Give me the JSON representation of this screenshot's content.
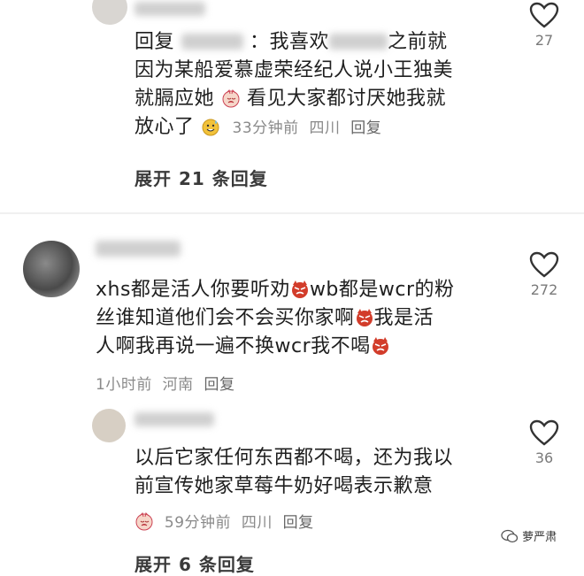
{
  "comments": [
    {
      "text": {
        "prefix": "回复",
        "mid": "我喜欢",
        "after_mid": "之前就",
        "line2": "因为某船爱慕虚荣经纪人说小王独美",
        "line3a": "就膈应她",
        "line3b": "看见大家都讨厌她我就",
        "line4": "放心了"
      },
      "meta": {
        "time": "33分钟前",
        "location": "四川",
        "reply": "回复"
      },
      "likes": "27",
      "expand": "展开 21 条回复"
    },
    {
      "text": {
        "l1a": "xhs都是活人你要听劝",
        "l1b": "wb都是wcr的粉",
        "l2a": "丝谁知道他们会不会买你家啊",
        "l2b": "我是活",
        "l3a": "人啊我再说一遍不换wcr我不喝"
      },
      "meta": {
        "time": "1小时前",
        "location": "河南",
        "reply": "回复"
      },
      "likes": "272"
    },
    {
      "text": {
        "line1": "以后它家任何东西都不喝，还为我以",
        "line2": "前宣传她家草莓牛奶好喝表示歉意"
      },
      "meta": {
        "time": "59分钟前",
        "location": "四川",
        "reply": "回复"
      },
      "likes": "36",
      "expand": "展开 6 条回复"
    }
  ],
  "watermark": "萝严肃",
  "colors": {
    "emoji_red": "#d23c2a",
    "emoji_yellow": "#f2c23a"
  },
  "icons": [
    "heart-outline-icon",
    "angry-devil-emoji",
    "crying-emoji",
    "sweat-smile-emoji",
    "wechat-logo-icon"
  ]
}
